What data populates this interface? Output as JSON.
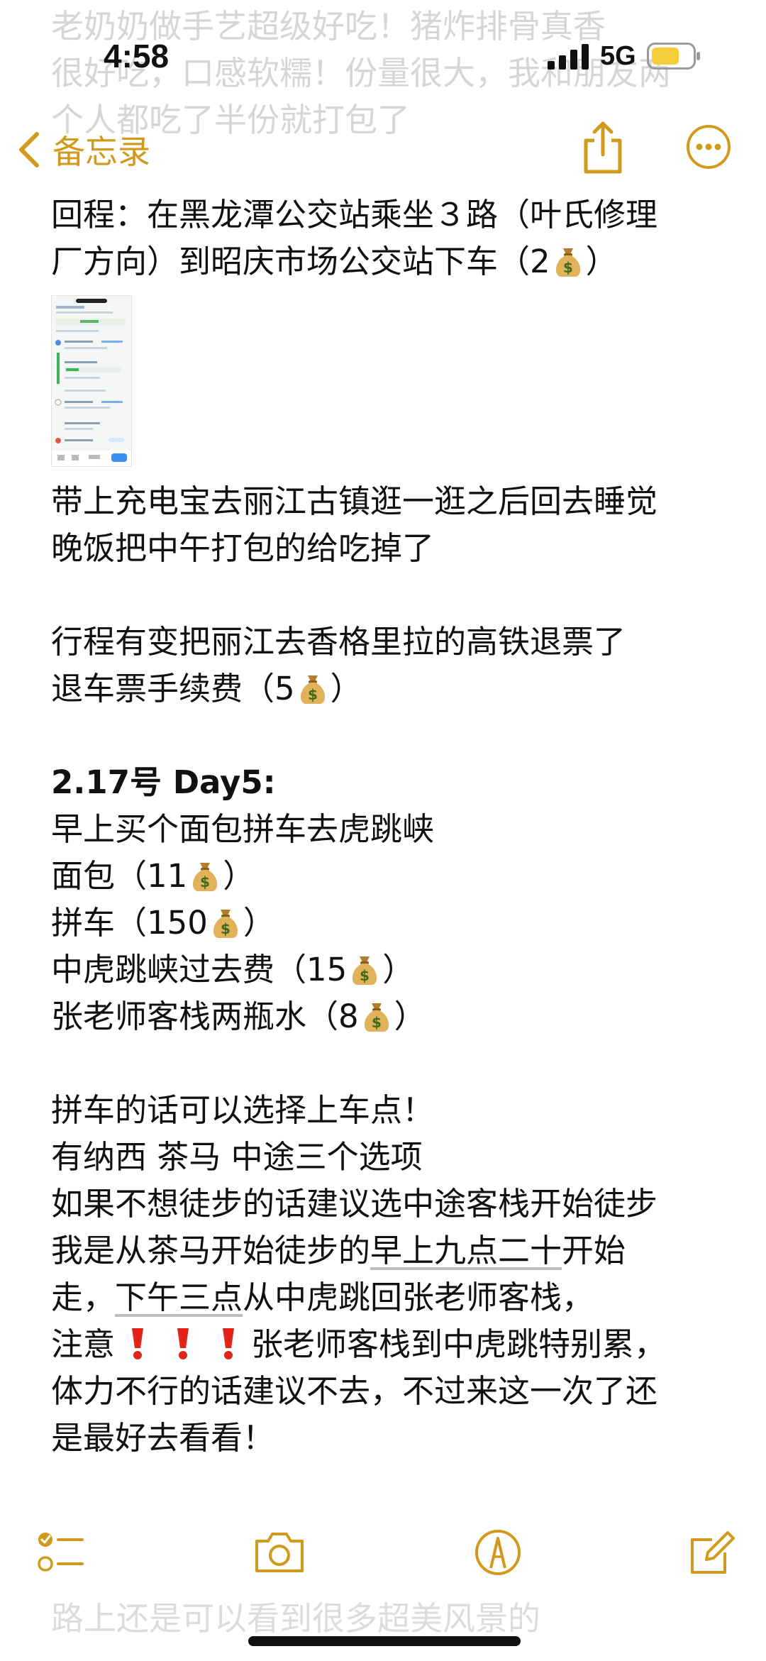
{
  "status_bar": {
    "time": "4:58",
    "network": "5G"
  },
  "nav": {
    "back_label": "备忘录"
  },
  "ghost": {
    "top_lines": [
      "老奶奶做手艺超级好吃！猪炸排骨真香",
      "很好吃，口感软糯！份量很大，我和朋友两",
      "个人都吃了半份就打包了"
    ],
    "bottom_line": "路上还是可以看到很多超美风景的"
  },
  "note": {
    "return_line1": "回程：在黑龙潭公交站乘坐３路（叶氏修理",
    "return_line2_pre": "厂方向）到昭庆市场公交站下车（2",
    "paren_close": "）",
    "p1_line1": "带上充电宝去丽江古镇逛一逛之后回去睡觉",
    "p1_line2": "晚饭把中午打包的给吃掉了",
    "p2_line1": "行程有变把丽江去香格里拉的高铁退票了",
    "p2_line2_pre": "退车票手续费（5",
    "day_heading": "2.17号 Day5:",
    "d_line1": "早上买个面包拼车去虎跳峡",
    "d_bread": "面包（11",
    "d_carpool": "拼车（150",
    "d_gorge": "中虎跳峡过去费（15",
    "d_water": "张老师客栈两瓶水（8",
    "t_line1": "拼车的话可以选择上车点！",
    "t_line2": "有纳西 茶马 中途三个选项",
    "t_line3": "如果不想徒步的话建议选中途客栈开始徒步",
    "t_line4_a": "我是从茶马开始徒步的",
    "t_line4_b": "早上九点二十",
    "t_line4_c": "开始",
    "t_line5_a": "走，",
    "t_line5_b": "下午三点",
    "t_line5_c": "从中虎跳回张老师客栈，",
    "t_line6_a": "注意",
    "t_line6_b": "张老师客栈到中虎跳特别累，",
    "t_line7": "体力不行的话建议不去，不过来这一次了还",
    "t_line8": "是最好去看看！"
  },
  "icons": {
    "money": "money-bag-icon",
    "alert": "exclamation-icon",
    "toolbar": [
      "checklist-icon",
      "camera-icon",
      "markup-pen-icon",
      "compose-icon"
    ]
  },
  "colors": {
    "accent": "#d29a1d",
    "alert": "#e0241b",
    "text": "#111111"
  }
}
